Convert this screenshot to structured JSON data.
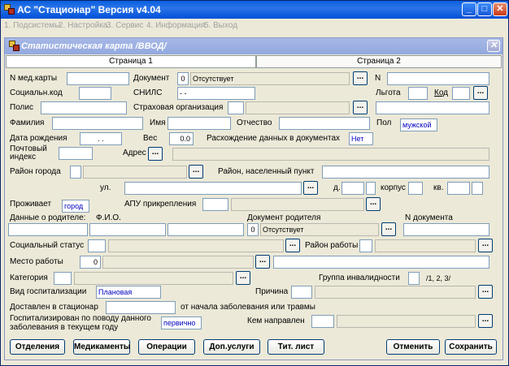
{
  "app": {
    "title": "АС \"Стационар\"   Версия  v4.04",
    "menu": [
      "1. Подсистемы",
      "2. Настройка",
      "3. Сервис",
      "4. Информация",
      "5. Выход"
    ],
    "controls": {
      "minimize": "_",
      "maximize": "□",
      "close": "✕"
    }
  },
  "card": {
    "title": "Статистическая карта  /ВВОД/",
    "close": "✕",
    "tabs": [
      "Страница 1",
      "Страница 2"
    ]
  },
  "labels": {
    "med_card_no": "N мед.карты",
    "document": "Документ",
    "n": "N",
    "social_code": "Социальн.код",
    "snils": "СНИЛС",
    "benefit": "Льгота",
    "code": "Код",
    "policy": "Полис",
    "insurer": "Страховая организация",
    "surname": "Фамилия",
    "name": "Имя",
    "patronymic": "Отчество",
    "sex": "Пол",
    "birth_date": "Дата рождения",
    "weight": "Вес",
    "doc_mismatch": "Расхождение данных в документах",
    "postal_index": "Почтовый индекс",
    "address": "Адрес",
    "city_district": "Район города",
    "district_locality": "Район, населенный пункт",
    "street": "ул.",
    "house": "д.",
    "building": "корпус",
    "apartment": "кв.",
    "lives": "Проживает",
    "apu": "АПУ прикрепления",
    "parent_data": "Данные о родителе:",
    "fio": "Ф.И.О.",
    "parent_doc": "Документ родителя",
    "doc_no": "N документа",
    "social_status": "Социальный статус",
    "work_district": "Район работы",
    "workplace": "Место работы",
    "category": "Категория",
    "disability_group": "Группа инвалидности",
    "disability_hint": "/1, 2, 3/",
    "hosp_type": "Вид госпитализации",
    "reason": "Причина",
    "delivered": "Доставлен в стационар",
    "since_onset": "от начала заболевания или травмы",
    "hospitalized": "Госпитализирован  по поводу данного заболевания в текущем году",
    "referred_by": "Кем направлен"
  },
  "values": {
    "doc_code": "0",
    "doc_name": "Отсутствует",
    "snils": " -  -",
    "sex": "мужской",
    "birth_date": " .  .",
    "weight": "0.0",
    "doc_mismatch": "Нет",
    "lives": "город",
    "parent_doc_code": "0",
    "parent_doc_name": "Отсутствует",
    "workplace_code": "0",
    "hosp_type": "Плановая",
    "hospitalized": "первично"
  },
  "ellipsis": "...",
  "buttons": {
    "departments": "Отделения",
    "medications": "Медикаменты",
    "operations": "Операции",
    "extra_services": "Доп.услуги",
    "title_sheet": "Тит. лист",
    "cancel": "Отменить",
    "save": "Сохранить"
  }
}
